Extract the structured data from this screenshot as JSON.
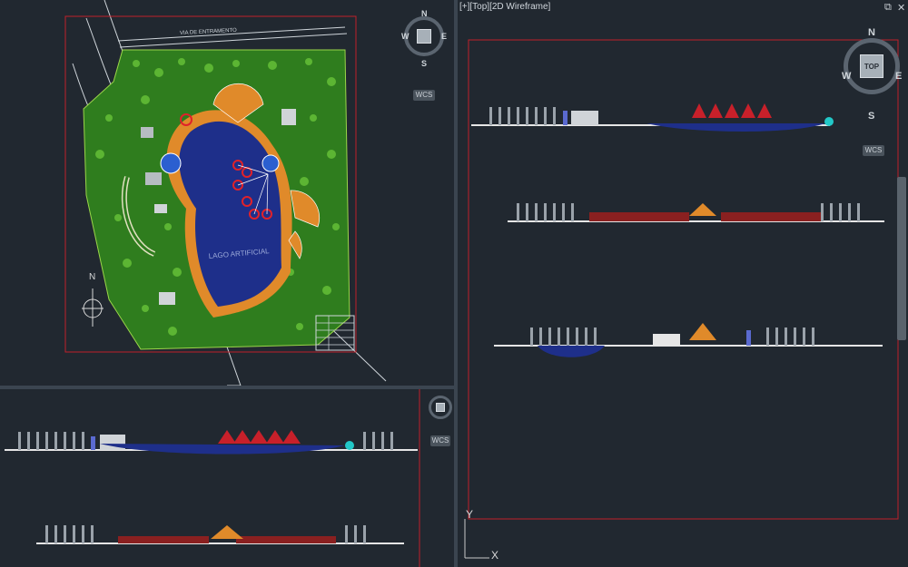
{
  "viewports": {
    "plan": {
      "wcs_label": "WCS",
      "road_label": "VIA DE ENTRAMENTO",
      "lake_label": "LAGO ARTIFICIAL",
      "north_label": "N"
    },
    "elevations_small": {
      "wcs_label": "WCS"
    },
    "main": {
      "title": "[+][Top][2D Wireframe]",
      "cube_top": "TOP",
      "dir_n": "N",
      "dir_s": "S",
      "dir_e": "E",
      "dir_w": "W",
      "wcs_label": "WCS"
    }
  },
  "small_cube": {
    "top": "",
    "dir_n": "N",
    "dir_s": "S",
    "dir_e": "E",
    "dir_w": "W"
  },
  "window_controls": {
    "restore": "⧉",
    "close": "✕"
  },
  "ucs": {
    "x": "X",
    "y": "Y"
  },
  "colors": {
    "background": "#212830",
    "frame": "#c0202a",
    "vegetation": "#2f7d1e",
    "water": "#1e2f8a",
    "path": "#e08a2a"
  }
}
